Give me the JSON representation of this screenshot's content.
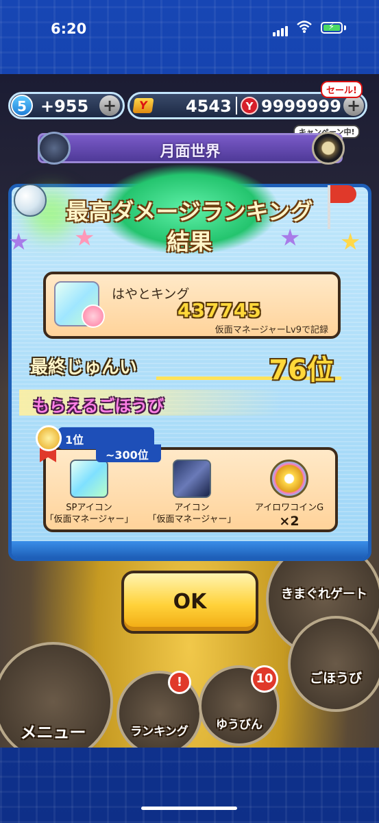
{
  "status_bar": {
    "time": "6:20"
  },
  "currency": {
    "level": "5",
    "stamina": "+955",
    "ticket_count": "4543",
    "coins": "9999999",
    "sale_badge": "セール!",
    "campaign_badge": "キャンペーン中!",
    "plus": "+"
  },
  "world": {
    "name": "月面世界"
  },
  "dialog": {
    "title_line1": "最高ダメージランキング",
    "title_line2": "結果",
    "record": {
      "player_name": "はやとキング",
      "score": "437745",
      "note": "仮面マネージャーLv9で記録"
    },
    "final_rank": {
      "label": "最終じゅんい",
      "value": "76位"
    },
    "rewards": {
      "header": "もらえるごほうび",
      "tier_top": "1位",
      "tier_bottom": "~300位",
      "items": [
        {
          "name_line1": "SPアイコン",
          "name_line2": "「仮面マネージャー」",
          "icon": "sp-icon-portrait"
        },
        {
          "name_line1": "アイコン",
          "name_line2": "「仮面マネージャー」",
          "icon": "icon-portrait"
        },
        {
          "name_line1": "アイロワコインG",
          "name_line2": "×2",
          "icon": "coin-g-icon"
        }
      ]
    },
    "ok_label": "OK"
  },
  "bottom_menu": {
    "menu": "メニュー",
    "ranking": "ランキング",
    "ranking_badge": "!",
    "mail": "ゆうびん",
    "mail_badge": "10",
    "kimagure": "きまぐれゲート",
    "rewards": "ごほうび"
  }
}
